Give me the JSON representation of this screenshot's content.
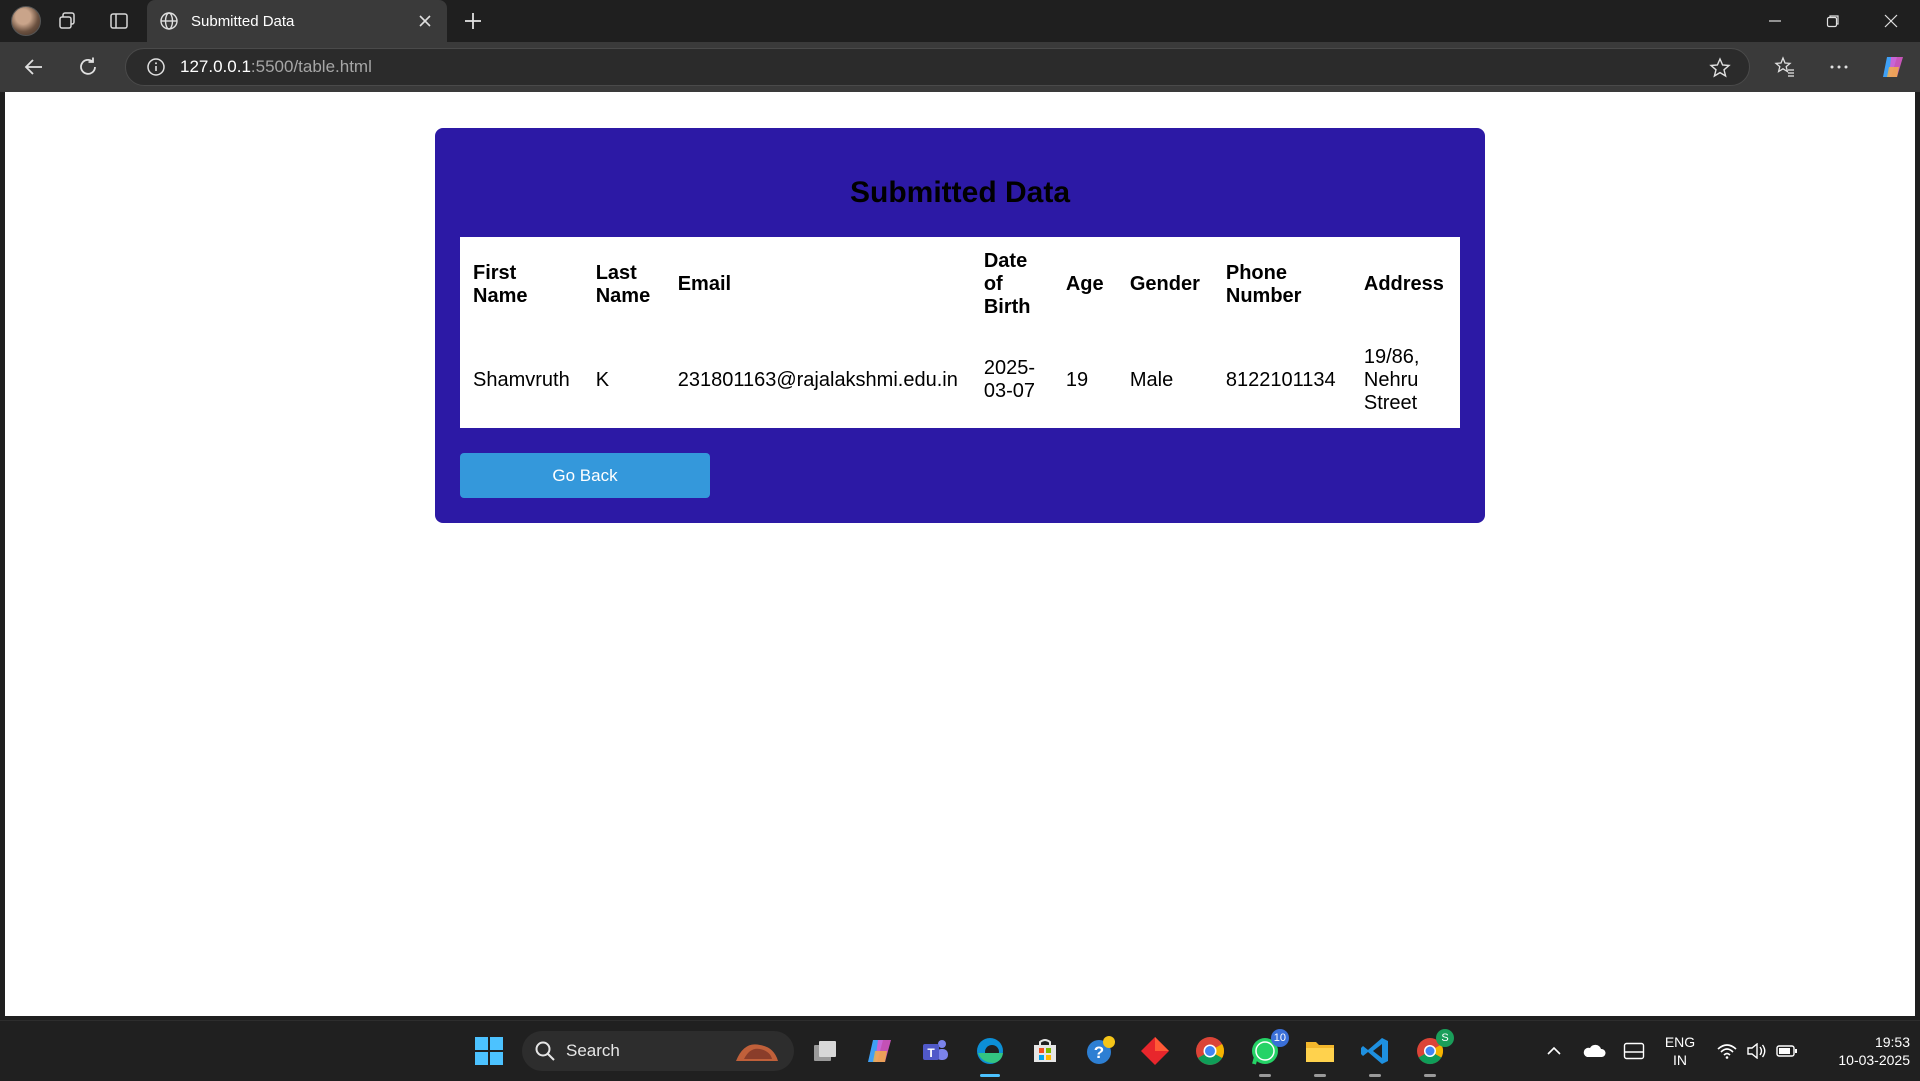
{
  "browser": {
    "tab_title": "Submitted Data",
    "url_host": "127.0.0.1",
    "url_path": ":5500/table.html"
  },
  "page": {
    "heading": "Submitted Data",
    "columns": [
      "First Name",
      "Last Name",
      "Email",
      "Date of Birth",
      "Age",
      "Gender",
      "Phone Number",
      "Address"
    ],
    "rows": [
      {
        "first_name": "Shamvruth",
        "last_name": "K",
        "email": "231801163@rajalakshmi.edu.in",
        "dob": "2025-03-07",
        "age": "19",
        "gender": "Male",
        "phone": "8122101134",
        "address": "19/86, Nehru Street"
      }
    ],
    "go_back_label": "Go Back",
    "card_color": "#2c19a5",
    "button_color": "#3498db"
  },
  "taskbar": {
    "search_label": "Search",
    "whatsapp_badge": "10",
    "chrome_profile_badge": "S",
    "lang_line1": "ENG",
    "lang_line2": "IN",
    "time": "19:53",
    "date": "10-03-2025"
  }
}
